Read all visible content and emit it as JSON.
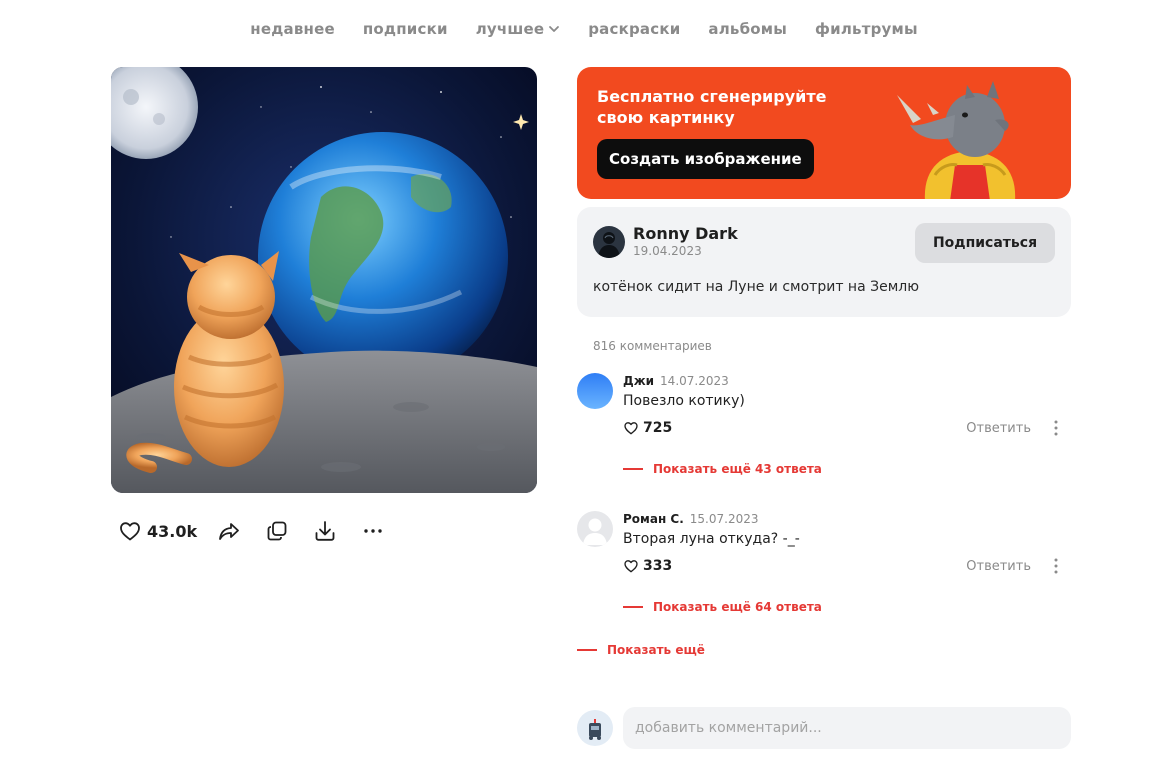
{
  "nav": {
    "items": [
      {
        "label": "недавнее"
      },
      {
        "label": "подписки"
      },
      {
        "label": "лучшее"
      },
      {
        "label": "раскраски"
      },
      {
        "label": "альбомы"
      },
      {
        "label": "фильтрумы"
      }
    ]
  },
  "post": {
    "likes": "43.0k",
    "icons": [
      "heart-icon",
      "share-icon",
      "copy-icon",
      "download-icon",
      "more-icon"
    ]
  },
  "promo": {
    "text": "Бесплатно сгенерируйте свою картинку",
    "button": "Создать изображение",
    "bg_color": "#f24a1f"
  },
  "author": {
    "name": "Ronny Dark",
    "date": "19.04.2023",
    "subscribe": "Подписаться",
    "prompt": "котёнок сидит на Луне и смотрит на Землю"
  },
  "comments": {
    "count_label": "816 комментариев",
    "items": [
      {
        "author": "Джи",
        "date": "14.07.2023",
        "text": "Повезло котику)",
        "likes": "725",
        "reply": "Ответить",
        "show_replies": "Показать ещё 43 ответа"
      },
      {
        "author": "Роман С.",
        "date": "15.07.2023",
        "text": "Вторая луна откуда? -_-",
        "likes": "333",
        "reply": "Ответить",
        "show_replies": "Показать ещё 64 ответа"
      }
    ],
    "show_more": "Показать ещё",
    "input_placeholder": "добавить комментарий...",
    "accent_color": "#e53935"
  }
}
